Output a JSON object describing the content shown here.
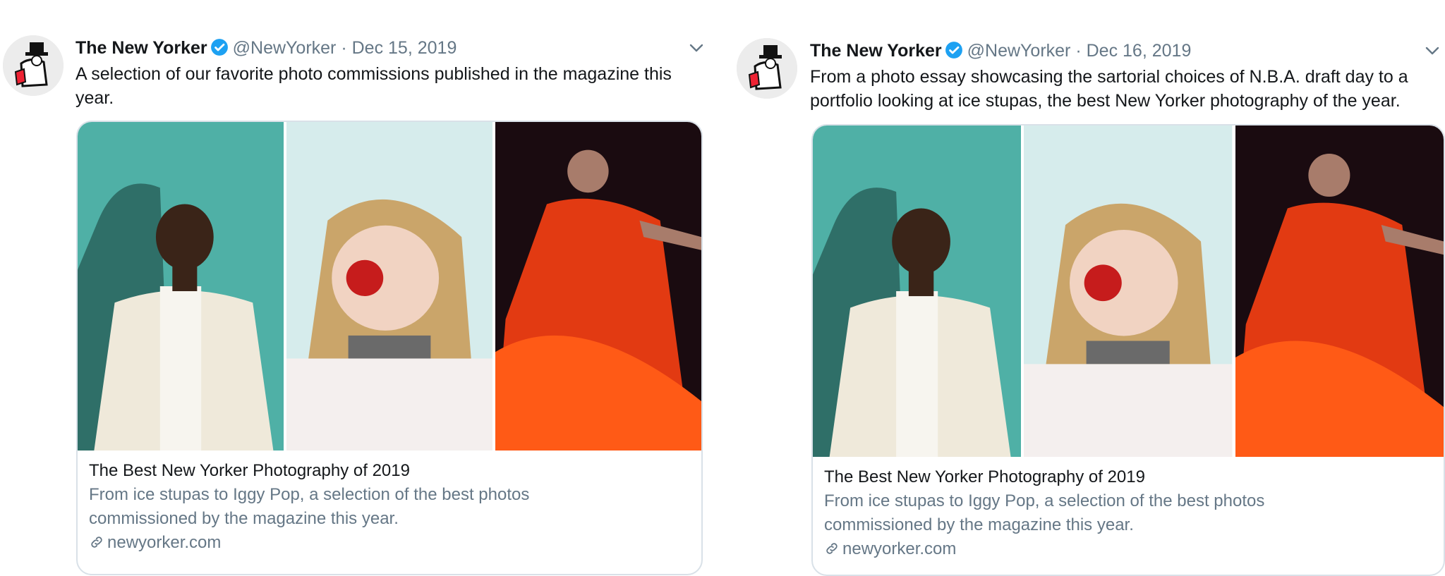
{
  "tweets": [
    {
      "author": "The New Yorker",
      "handle": "@NewYorker",
      "separator": "·",
      "date": "Dec 15, 2019",
      "text": "A selection of our favorite photo commissions published in the magazine this year.",
      "card": {
        "title": "The Best New Yorker Photography of 2019",
        "description": "From ice stupas to Iggy Pop, a selection of the best photos commissioned by the magazine this year.",
        "domain": "newyorker.com"
      }
    },
    {
      "author": "The New Yorker",
      "handle": "@NewYorker",
      "separator": "·",
      "date": "Dec 16, 2019",
      "text": "From a photo essay showcasing the sartorial choices of N.B.A. draft day to a portfolio looking at ice stupas, the best New Yorker photography of the year.",
      "card": {
        "title": "The Best New Yorker Photography of 2019",
        "description": "From ice stupas to Iggy Pop, a selection of the best photos commissioned by the magazine this year.",
        "domain": "newyorker.com"
      }
    }
  ],
  "colors": {
    "verified": "#1da1f2",
    "secondary_text": "#657786",
    "card_border": "#d9e1e8"
  },
  "icons": {
    "verified": "verified-badge-icon",
    "menu": "chevron-down-icon",
    "link": "link-icon"
  }
}
